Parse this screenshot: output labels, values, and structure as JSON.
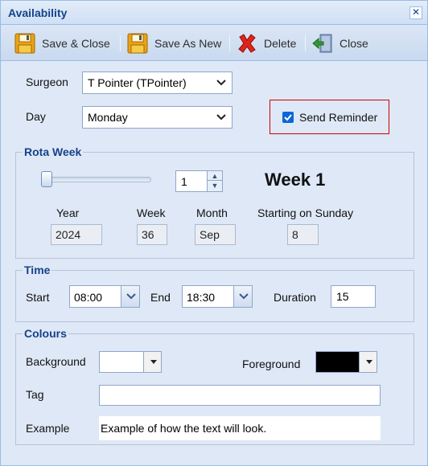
{
  "window": {
    "title": "Availability",
    "close_glyph": "✕"
  },
  "toolbar": {
    "buttons": [
      {
        "label": "Save & Close",
        "icon": "floppy-disk-icon"
      },
      {
        "label": "Save As New",
        "icon": "floppy-disk-icon"
      },
      {
        "label": "Delete",
        "icon": "red-x-icon"
      },
      {
        "label": "Close",
        "icon": "exit-door-icon"
      }
    ]
  },
  "form": {
    "surgeon_label": "Surgeon",
    "surgeon_value": "T Pointer (TPointer)",
    "day_label": "Day",
    "day_value": "Monday",
    "reminder_label": "Send Reminder",
    "reminder_checked": true
  },
  "rota": {
    "legend": "Rota Week",
    "slider_value": 1,
    "spinner_value": "1",
    "week_title": "Week 1",
    "year_label": "Year",
    "year_value": "2024",
    "week_label": "Week",
    "week_value": "36",
    "month_label": "Month",
    "month_value": "Sep",
    "start_label": "Starting on Sunday",
    "start_value": "8"
  },
  "time": {
    "legend": "Time",
    "start_label": "Start",
    "start_value": "08:00",
    "end_label": "End",
    "end_value": "18:30",
    "duration_label": "Duration",
    "duration_value": "15"
  },
  "colours": {
    "legend": "Colours",
    "background_label": "Background",
    "background_color": "#ffffff",
    "foreground_label": "Foreground",
    "foreground_color": "#000000",
    "tag_label": "Tag",
    "tag_value": "",
    "example_label": "Example",
    "example_text": "Example of how the text will look."
  },
  "colors": {
    "title": "#15428b",
    "panel": "#dfe8f6",
    "reminder_border": "#cc0000",
    "checkbox": "#0b66d6"
  }
}
